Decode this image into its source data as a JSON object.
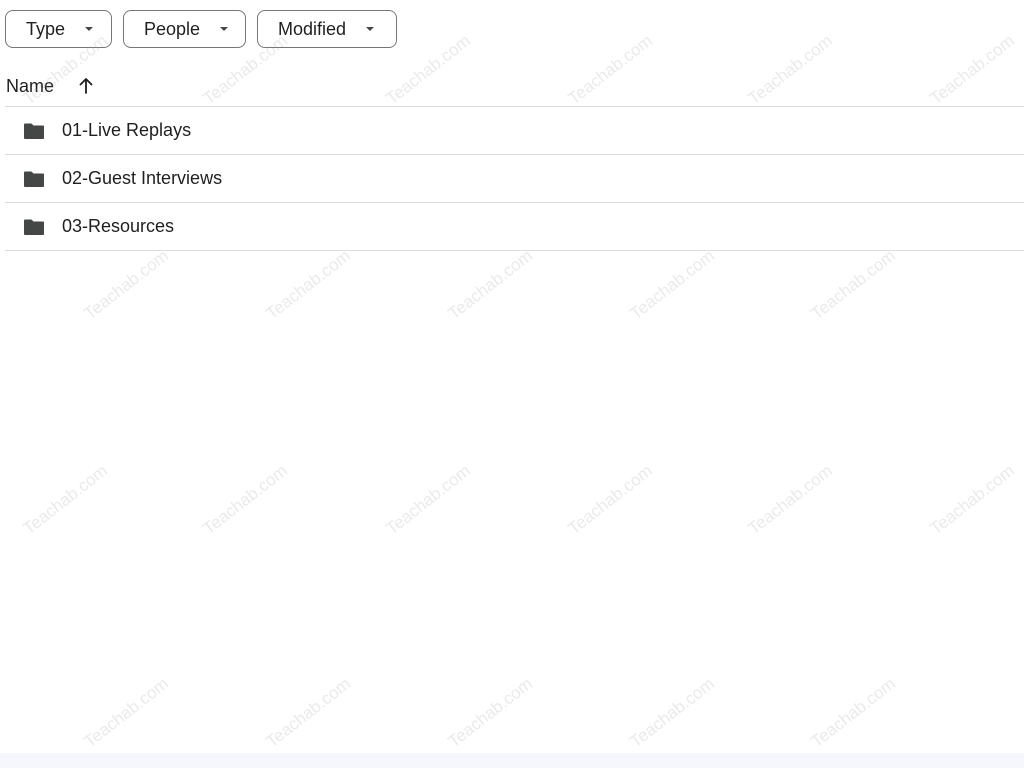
{
  "filters": {
    "type_label": "Type",
    "people_label": "People",
    "modified_label": "Modified"
  },
  "list_header": {
    "name_label": "Name",
    "sort_direction": "ascending"
  },
  "files": [
    {
      "name": "01-Live Replays",
      "kind": "folder"
    },
    {
      "name": "02-Guest Interviews",
      "kind": "folder"
    },
    {
      "name": "03-Resources",
      "kind": "folder"
    }
  ],
  "watermark": "Teachab.com",
  "colors": {
    "border": "#747775",
    "divider": "#dadce0",
    "text": "#1f1f1f",
    "folder_icon": "#444746"
  }
}
